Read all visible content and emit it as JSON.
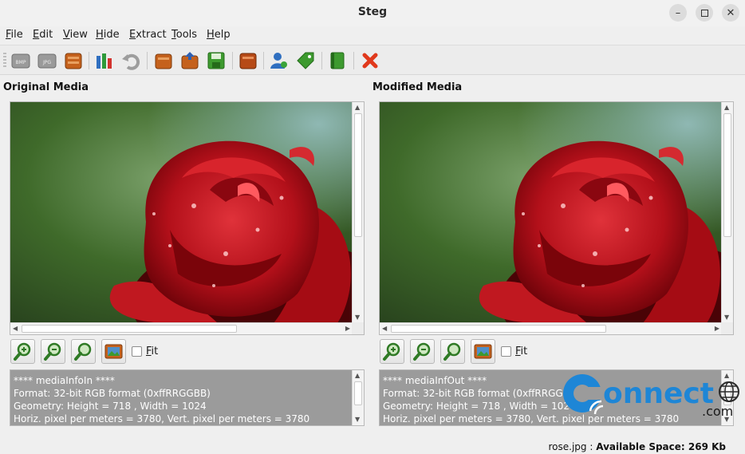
{
  "window": {
    "title": "Steg"
  },
  "menu": [
    {
      "key": "F",
      "rest": "ile"
    },
    {
      "key": "E",
      "rest": "dit"
    },
    {
      "key": "V",
      "rest": "iew"
    },
    {
      "key": "H",
      "rest": "ide"
    },
    {
      "key": "E",
      "rest": "xtract"
    },
    {
      "key": "T",
      "rest": "ools"
    },
    {
      "key": "H",
      "rest": "elp"
    }
  ],
  "toolbar": {
    "bmp_label": "BMP",
    "jpg_label": "JPG"
  },
  "original": {
    "title": "Original Media",
    "info_lines": [
      "**** mediaInfoIn ****",
      "Format: 32-bit RGB format (0xffRRGGBB)",
      "Geometry: Height = 718 , Width = 1024",
      "Horiz. pixel per meters =  3780, Vert. pixel per meters = 3780"
    ],
    "fit_key": "F",
    "fit_rest": "it"
  },
  "modified": {
    "title": "Modified Media",
    "info_lines": [
      "**** mediaInfOut ****",
      "Format: 32-bit RGB format (0xffRRGGBB)",
      "Geometry: Height = 718 , Width = 1024",
      "Horiz. pixel per meters =  3780, Vert. pixel per meters = 3780"
    ],
    "fit_key": "F",
    "fit_rest": "it"
  },
  "status": {
    "filename": "rose.jpg",
    "label": "Available Space: 269 Kb"
  },
  "watermark": {
    "brand": "onnect",
    "tld": ".com"
  },
  "colors": {
    "info_bg": "#9b9b9b",
    "rose_red": "#b3101a",
    "bg_green": "#3f6a2a"
  }
}
